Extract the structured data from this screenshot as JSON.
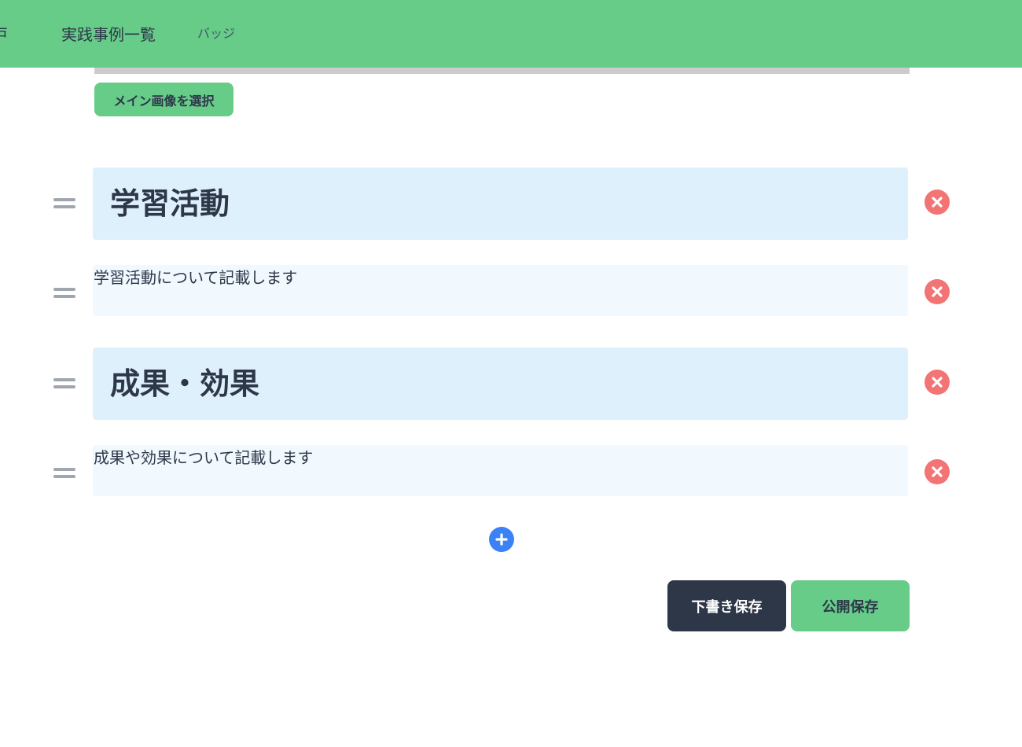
{
  "nav": {
    "partial_label": "戸",
    "cases_label": "実践事例一覧",
    "badge_label": "バッジ"
  },
  "editor": {
    "select_image_label": "メイン画像を選択",
    "blocks": [
      {
        "type": "heading",
        "text": "学習活動"
      },
      {
        "type": "paragraph",
        "text": "学習活動について記載します"
      },
      {
        "type": "heading",
        "text": "成果・効果"
      },
      {
        "type": "paragraph",
        "text": "成果や効果について記載します"
      }
    ]
  },
  "actions": {
    "draft_save_label": "下書き保存",
    "publish_save_label": "公開保存"
  },
  "icons": {
    "drag": "drag-handle-icon",
    "delete": "close-icon",
    "add": "plus-icon"
  },
  "colors": {
    "brand_green": "#66cc88",
    "heading_block_bg": "#dff0fd",
    "paragraph_block_bg": "#f1f8fe",
    "delete_red": "#f27474",
    "add_blue": "#3b82f6",
    "dark_button": "#2d3748"
  }
}
